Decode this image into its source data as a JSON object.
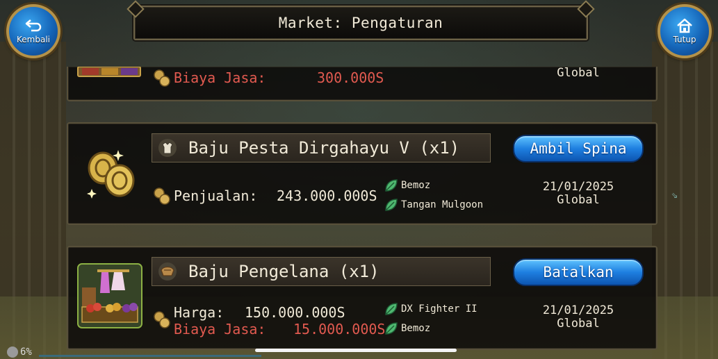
{
  "header": {
    "title": "Market: Pengaturan"
  },
  "nav": {
    "back_label": "Kembali",
    "close_label": "Tutup"
  },
  "listings": [
    {
      "name": "",
      "rows": [
        {
          "label": "Biaya Jasa:",
          "value": "300.000S",
          "color": "red"
        }
      ],
      "date": "",
      "region": "Global"
    },
    {
      "name": "Baju Pesta Dirgahayu V (x1)",
      "action": "Ambil Spina",
      "rows": [
        {
          "label": "Penjualan:",
          "value": "243.000.000S",
          "color": "white"
        }
      ],
      "sellers": [
        "Bemoz",
        "Tangan Mulgoon"
      ],
      "date": "21/01/2025",
      "region": "Global"
    },
    {
      "name": "Baju Pengelana (x1)",
      "action": "Batalkan",
      "rows": [
        {
          "label": "Harga:",
          "value": "150.000.000S",
          "color": "white"
        },
        {
          "label": "Biaya Jasa:",
          "value": "15.000.000S",
          "color": "red"
        }
      ],
      "sellers": [
        "DX Fighter II",
        "Bemoz"
      ],
      "date": "21/01/2025",
      "region": "Global"
    }
  ],
  "status": {
    "percent": "6%"
  },
  "colors": {
    "accent_blue": "#1e7fe0",
    "fee_red": "#e25a50",
    "text": "#f1ead8",
    "frame": "#58503a"
  },
  "icons": [
    "back-arrow-icon",
    "home-icon",
    "coins-icon",
    "leaf-icon",
    "costume-icon",
    "gold-coins-icon",
    "clothing-stall-icon"
  ]
}
